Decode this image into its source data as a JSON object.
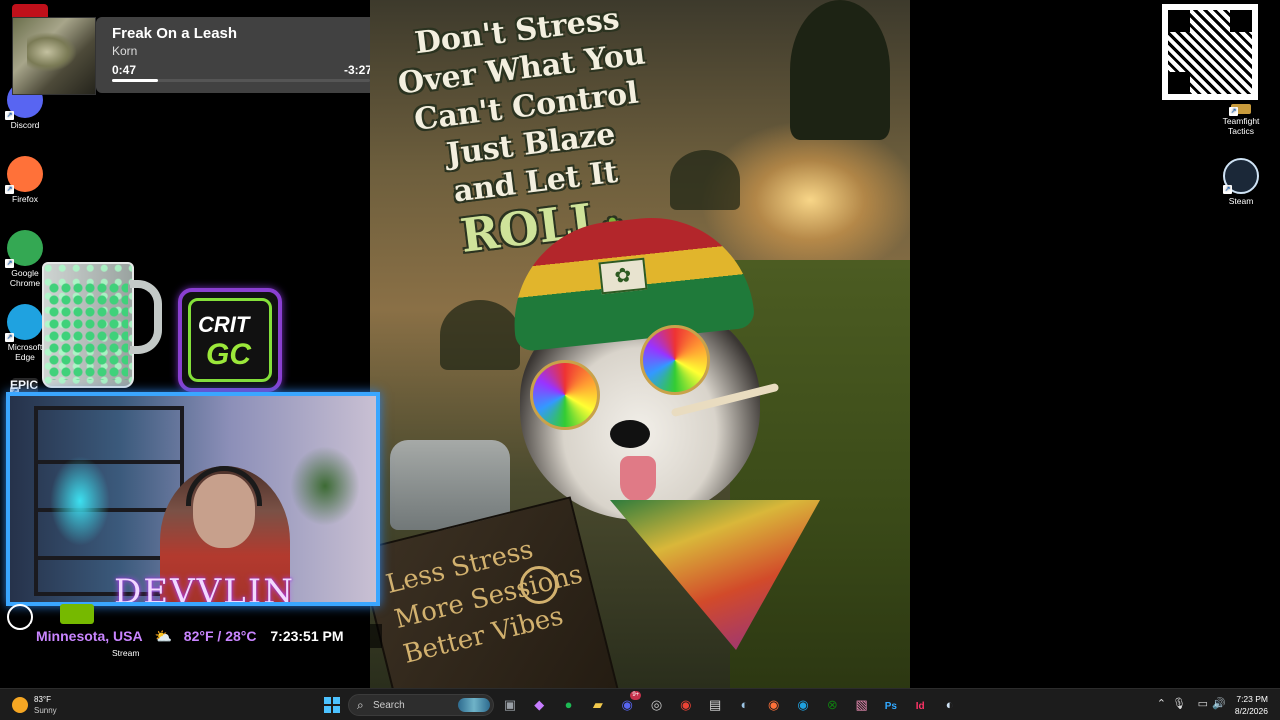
{
  "media": {
    "title": "Freak On a Leash",
    "artist": "Korn",
    "elapsed": "0:47",
    "remaining": "-3:27",
    "progress_fraction": 0.18
  },
  "desktop_left": [
    {
      "label": "Discord",
      "icon": "discord-icon",
      "color": "#5865f2"
    },
    {
      "label": "Firefox",
      "icon": "firefox-icon",
      "color": "#ff7139"
    },
    {
      "label": "Google Chrome",
      "icon": "chrome-icon",
      "color": "#34a853"
    },
    {
      "label": "Microsoft Edge",
      "icon": "edge-icon",
      "color": "#1fa2e0"
    },
    {
      "label": "EPIC",
      "icon": "epic-games-icon",
      "color": "#2a2a2a"
    }
  ],
  "desktop_right": [
    {
      "label": "Teamfight Tactics",
      "icon": "teamfight-tactics-icon",
      "color": "#c89b3c"
    },
    {
      "label": "Steam",
      "icon": "steam-icon",
      "color": "#1b2838"
    }
  ],
  "poster": {
    "headline_lines": [
      "Don't Stress",
      "Over What You",
      "Can't Control",
      "Just Blaze",
      "and Let It"
    ],
    "headline_final": "ROLL",
    "sign_lines": [
      "Less Stress",
      "More Sessions",
      "Better Vibes"
    ]
  },
  "crit_logo": {
    "line1": "CRIT",
    "line2": "GC"
  },
  "webcam": {
    "name_overlay": "DEVVLIN"
  },
  "weather_overlay": {
    "location": "Minnesota, USA",
    "weather_icon": "partly-cloudy-icon",
    "temperature": "82°F / 28°C",
    "time": "7:23:51 PM"
  },
  "nvidia_label": "Stream",
  "taskbar": {
    "weather_temp": "83°F",
    "weather_condition": "Sunny",
    "search_placeholder": "Search",
    "apps": [
      {
        "name": "task-view",
        "glyph": "▣",
        "color": "#9aa0a6"
      },
      {
        "name": "copilot",
        "glyph": "◆",
        "color": "#c77dff"
      },
      {
        "name": "spotify",
        "glyph": "●",
        "color": "#1db954"
      },
      {
        "name": "file-explorer",
        "glyph": "▰",
        "color": "#f2c94c"
      },
      {
        "name": "discord",
        "glyph": "◉",
        "color": "#5865f2",
        "badge": "9+"
      },
      {
        "name": "obs",
        "glyph": "◎",
        "color": "#cccccc"
      },
      {
        "name": "chrome",
        "glyph": "◉",
        "color": "#ea4335"
      },
      {
        "name": "store",
        "glyph": "▤",
        "color": "#dddddd"
      },
      {
        "name": "steam",
        "glyph": "◐",
        "color": "#9cc4e4"
      },
      {
        "name": "firefox",
        "glyph": "◉",
        "color": "#ff7139"
      },
      {
        "name": "edge",
        "glyph": "◉",
        "color": "#1fa2e0"
      },
      {
        "name": "xbox",
        "glyph": "⊗",
        "color": "#107c10"
      },
      {
        "name": "photos",
        "glyph": "▧",
        "color": "#e58ab0"
      },
      {
        "name": "photoshop",
        "glyph": "Ps",
        "color": "#31a8ff"
      },
      {
        "name": "indesign",
        "glyph": "Id",
        "color": "#ff3366"
      },
      {
        "name": "steam-running",
        "glyph": "◐",
        "color": "#cfe3f5"
      }
    ],
    "tray_time": "7:23 PM",
    "tray_date": "8/2/2026"
  }
}
